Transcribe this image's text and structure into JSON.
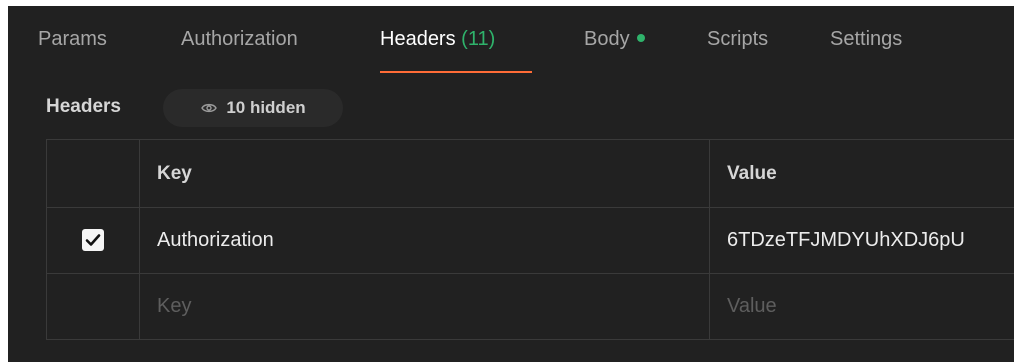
{
  "tabs": [
    {
      "label": "Params"
    },
    {
      "label": "Authorization"
    },
    {
      "label": "Headers",
      "count": "(11)",
      "active": true
    },
    {
      "label": "Body",
      "indicator": "green-dot"
    },
    {
      "label": "Scripts"
    },
    {
      "label": "Settings"
    }
  ],
  "headers_section": {
    "title": "Headers",
    "hidden_toggle": {
      "icon": "eye-icon",
      "label": "10 hidden"
    }
  },
  "table": {
    "columns": {
      "key": "Key",
      "value": "Value"
    },
    "rows": [
      {
        "checked": true,
        "key": "Authorization",
        "value": "6TDzeTFJMDYUhXDJ6pU"
      }
    ],
    "new_row": {
      "key_placeholder": "Key",
      "value_placeholder": "Value"
    }
  },
  "colors": {
    "background": "#212121",
    "active_tab_underline": "#ff6c37",
    "count_green": "#2fb36b"
  }
}
